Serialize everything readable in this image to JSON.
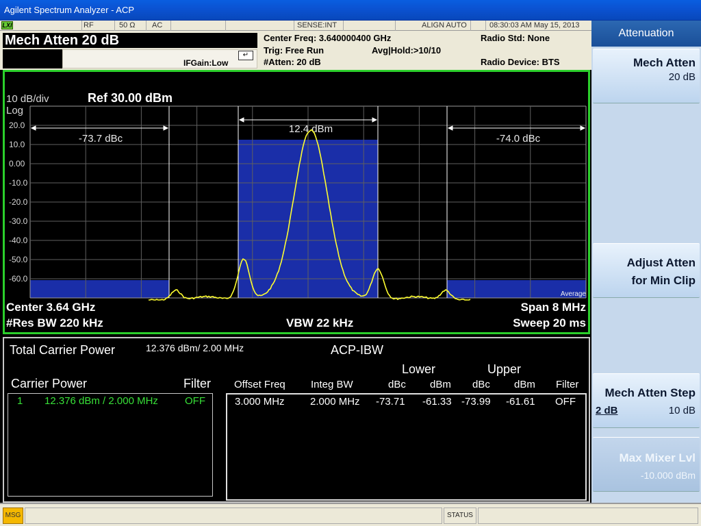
{
  "window": {
    "title": "Agilent Spectrum Analyzer - ACP"
  },
  "status_strip": {
    "logo": "LXI",
    "rf": "RF",
    "impedance": "50 Ω",
    "coupling": "AC",
    "sense": "SENSE:INT",
    "align": "ALIGN AUTO",
    "datetime": "08:30:03 AM May 15, 2013"
  },
  "header": {
    "mode_title": "Mech Atten  20 dB",
    "ifgain": "IFGain:Low",
    "center_freq": "Center Freq: 3.640000400 GHz",
    "trig": "Trig: Free Run",
    "avg_hold": "Avg|Hold:>10/10",
    "atten": "#Atten: 20 dB",
    "radio_std": "Radio Std: None",
    "radio_device": "Radio Device: BTS"
  },
  "graph": {
    "scale": "10 dB/div",
    "scale_type": "Log",
    "ref_level": "Ref 30.00 dBm",
    "y_ticks": [
      "20.0",
      "10.0",
      "0.00",
      "-10.0",
      "-20.0",
      "-30.0",
      "-40.0",
      "-50.0",
      "-60.0"
    ],
    "lower_offset_label": "-73.7 dBc",
    "carrier_label": "12.4 dBm",
    "upper_offset_label": "-74.0 dBc",
    "trace_mode": "Average",
    "center": "Center  3.64 GHz",
    "span": "Span 8 MHz",
    "res_bw": "#Res BW  220 kHz",
    "vbw": "VBW  22 kHz",
    "sweep": "Sweep  20 ms",
    "colors": {
      "frame": "#2bcf2b",
      "trace": "#ffff30",
      "band": "#1a2ea8",
      "grid": "#6e6e6e"
    }
  },
  "results": {
    "total_label": "Total Carrier Power",
    "total_value": "12.376 dBm/ 2.00 MHz",
    "mode_label": "ACP-IBW",
    "carrier_header": "Carrier Power",
    "filter_header": "Filter",
    "carrier_row": {
      "num": "1",
      "power": "12.376 dBm /  2.000 MHz",
      "filter": "OFF"
    },
    "offset_headers": {
      "lower": "Lower",
      "upper": "Upper",
      "offset_freq": "Offset Freq",
      "integ_bw": "Integ BW",
      "dbc": "dBc",
      "dbm": "dBm",
      "filter": "Filter"
    },
    "offset_row": {
      "offset_freq": "3.000 MHz",
      "integ_bw": "2.000 MHz",
      "lower_dbc": "-73.71",
      "lower_dbm": "-61.33",
      "upper_dbc": "-73.99",
      "upper_dbm": "-61.61",
      "filter": "OFF"
    }
  },
  "softkeys": {
    "title": "Attenuation",
    "mech_atten": {
      "label": "Mech Atten",
      "value": "20 dB"
    },
    "adjust_atten": {
      "line1": "Adjust Atten",
      "line2": "for Min Clip"
    },
    "mech_atten_step": {
      "label": "Mech Atten Step",
      "opt1": "2 dB",
      "opt2": "10 dB"
    },
    "max_mixer_lvl": {
      "label": "Max Mixer Lvl",
      "value": "-10.000 dBm"
    }
  },
  "bottom_bar": {
    "msg": "MSG",
    "status": "STATUS"
  }
}
